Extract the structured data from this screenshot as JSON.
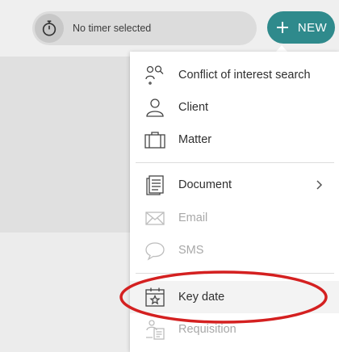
{
  "timer": {
    "label": "No timer selected"
  },
  "new_button": {
    "label": "NEW",
    "color": "#2f8a8c"
  },
  "menu": {
    "items": [
      {
        "label": "Conflict of interest search",
        "icon": "conflict-search-icon",
        "enabled": true
      },
      {
        "label": "Client",
        "icon": "person-icon",
        "enabled": true
      },
      {
        "label": "Matter",
        "icon": "briefcase-icon",
        "enabled": true
      },
      {
        "label": "Document",
        "icon": "document-icon",
        "enabled": true,
        "has_submenu": true
      },
      {
        "label": "Email",
        "icon": "envelope-icon",
        "enabled": false
      },
      {
        "label": "SMS",
        "icon": "chat-bubble-icon",
        "enabled": false
      },
      {
        "label": "Key date",
        "icon": "calendar-star-icon",
        "enabled": true,
        "highlighted": true
      },
      {
        "label": "Requisition",
        "icon": "requisition-icon",
        "enabled": false
      }
    ]
  },
  "annotation": {
    "color": "#d42020",
    "target": "Key date"
  }
}
